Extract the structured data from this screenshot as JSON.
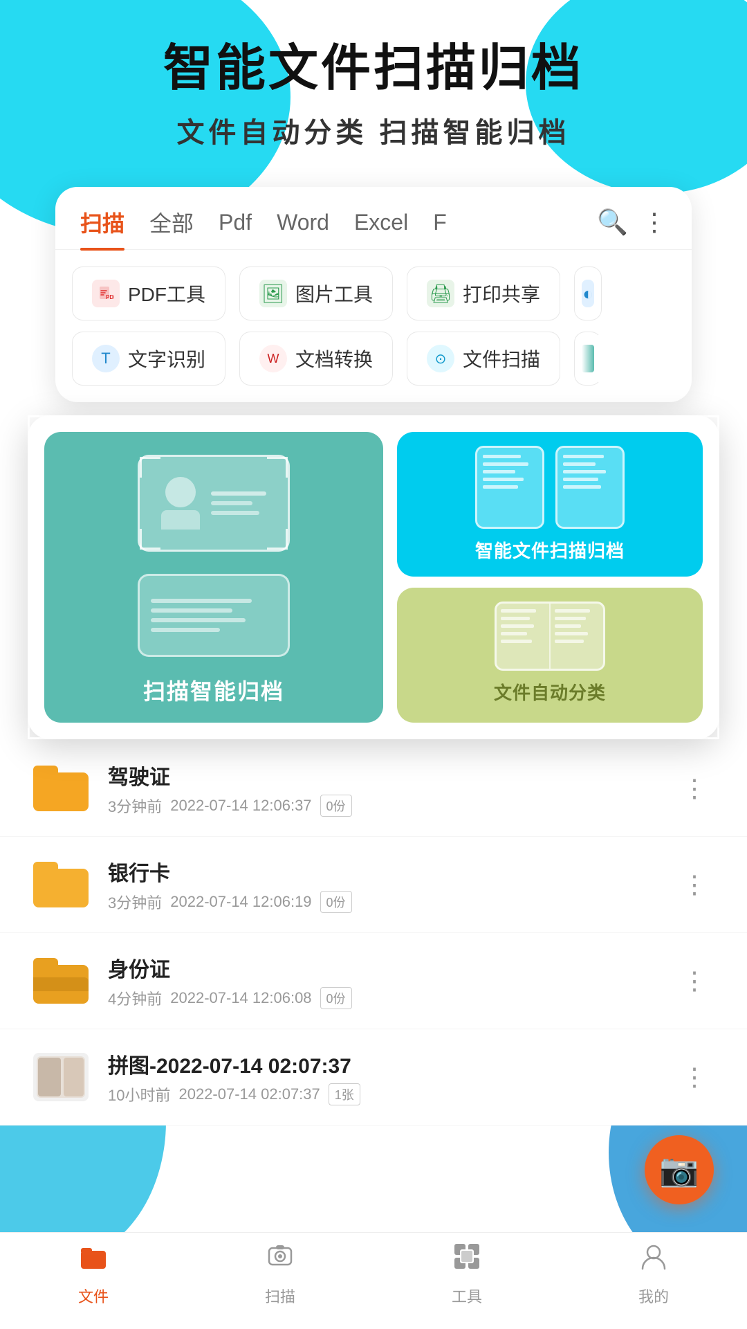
{
  "header": {
    "title": "智能文件扫描归档",
    "subtitle": "文件自动分类   扫描智能归档"
  },
  "tabs": {
    "items": [
      {
        "label": "扫描",
        "active": true
      },
      {
        "label": "全部",
        "active": false
      },
      {
        "label": "Pdf",
        "active": false
      },
      {
        "label": "Word",
        "active": false
      },
      {
        "label": "Excel",
        "active": false
      },
      {
        "label": "F",
        "active": false
      }
    ]
  },
  "tools": {
    "row1": [
      {
        "icon": "PDF",
        "label": "PDF工具"
      },
      {
        "icon": "IMG",
        "label": "图片工具"
      },
      {
        "icon": "PRT",
        "label": "打印共享"
      }
    ],
    "row2": [
      {
        "icon": "TXT",
        "label": "文字识别"
      },
      {
        "icon": "DOC",
        "label": "文档转换"
      },
      {
        "icon": "SCN",
        "label": "文件扫描"
      }
    ]
  },
  "feature_popup": {
    "left_label": "扫描智能归档",
    "right_top_label": "智能文件扫描归档",
    "right_bottom_label": "文件自动分类"
  },
  "files": [
    {
      "name": "驾驶证",
      "time": "3分钟前",
      "date": "2022-07-14 12:06:37",
      "count": "0份",
      "type": "folder"
    },
    {
      "name": "银行卡",
      "time": "3分钟前",
      "date": "2022-07-14 12:06:19",
      "count": "0份",
      "type": "folder"
    },
    {
      "name": "身份证",
      "time": "4分钟前",
      "date": "2022-07-14 12:06:08",
      "count": "0份",
      "type": "folder-open"
    },
    {
      "name": "拼图-2022-07-14 02:07:37",
      "time": "10小时前",
      "date": "2022-07-14 02:07:37",
      "count": "1张",
      "type": "image"
    }
  ],
  "nav": {
    "items": [
      {
        "label": "文件",
        "icon": "📁",
        "active": true
      },
      {
        "label": "扫描",
        "icon": "📷",
        "active": false
      },
      {
        "label": "工具",
        "icon": "⊞",
        "active": false
      },
      {
        "label": "我的",
        "icon": "👤",
        "active": false
      }
    ]
  }
}
